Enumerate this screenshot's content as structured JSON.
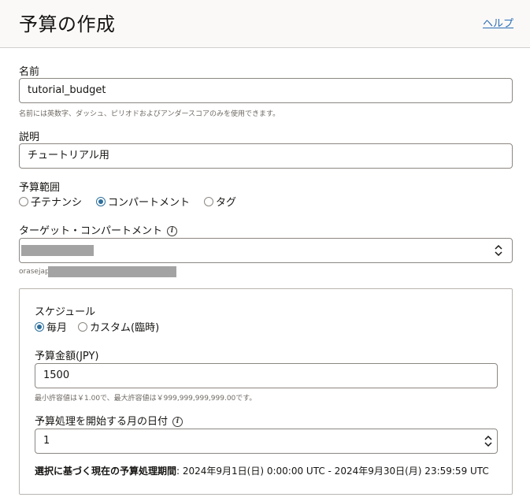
{
  "header": {
    "title": "予算の作成",
    "help": "ヘルプ"
  },
  "name": {
    "label": "名前",
    "value": "tutorial_budget",
    "hint": "名前には英数字、ダッシュ、ピリオドおよびアンダースコアのみを使用できます。"
  },
  "description": {
    "label": "説明",
    "value": "チュートリアル用"
  },
  "scope": {
    "label": "予算範囲",
    "options": [
      "子テナンシ",
      "コンパートメント",
      "タグ"
    ],
    "selected": "コンパートメント"
  },
  "target_compartment": {
    "label": "ターゲット・コンパートメント",
    "ocid_prefix": "orasejap"
  },
  "schedule": {
    "label": "スケジュール",
    "options": [
      "毎月",
      "カスタム(臨時)"
    ],
    "selected": "毎月"
  },
  "amount": {
    "label": "予算金額(JPY)",
    "value": "1500",
    "hint": "最小許容値は￥1.00で、最大許容値は￥999,999,999,999.00です。"
  },
  "start_day": {
    "label": "予算処理を開始する月の日付",
    "value": "1"
  },
  "period": {
    "label": "選択に基づく現在の予算処理期間",
    "value": ": 2024年9月1日(日) 0:00:00 UTC - 2024年9月30日(月) 23:59:59 UTC"
  }
}
